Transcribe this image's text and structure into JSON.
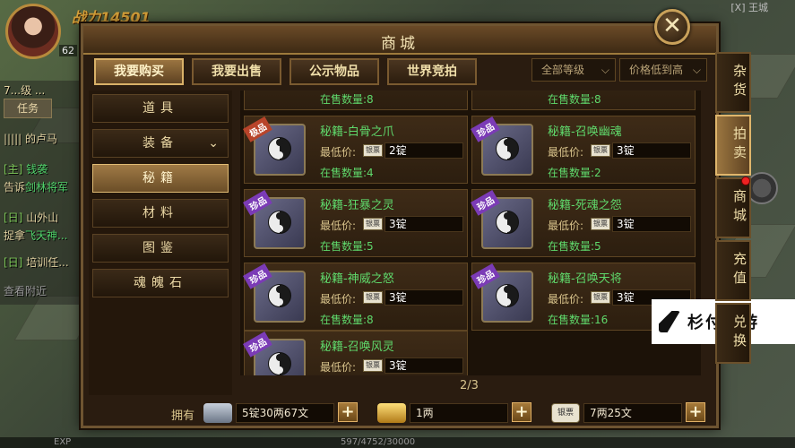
{
  "hud": {
    "power": "战力14501",
    "avatar_level": "62",
    "top_right_tag": "[X] 王城",
    "task_tab": "任务",
    "chat": [
      {
        "prefix": "7...级 ...",
        "text": ""
      },
      {
        "prefix": "||||| 的卢马",
        "text": ""
      },
      {
        "prefix": "[主]",
        "text": " 钱袭"
      },
      {
        "prefix": "告诉",
        "text": "剑林将军"
      },
      {
        "prefix": "[日]",
        "text": " 山外山"
      },
      {
        "prefix": "捉拿",
        "text": "飞天神..."
      },
      {
        "prefix": "[日]",
        "text": " 培训任..."
      },
      {
        "prefix": "查看附近",
        "text": ""
      }
    ],
    "bottom_status": "597/4752/30000",
    "exp_label": "EXP"
  },
  "shop": {
    "title": "商城",
    "close_icon": "close-icon",
    "tabs": [
      "我要购买",
      "我要出售",
      "公示物品",
      "世界竞拍"
    ],
    "active_tab": 0,
    "filters": {
      "level": "全部等级",
      "sort": "价格低到高"
    },
    "categories": [
      "道具",
      "装备",
      "秘籍",
      "材料",
      "图鉴",
      "魂魄石"
    ],
    "active_category": 2,
    "side_tabs": [
      "杂货",
      "拍卖",
      "商城",
      "充值",
      "兑换"
    ],
    "active_side_tab": 1,
    "labels": {
      "price": "最低价:",
      "stock": "在售数量:",
      "coin_icon": "银票",
      "owned": "拥有"
    },
    "partial_top_stocks": [
      "在售数量:8",
      "在售数量:8"
    ],
    "items": [
      {
        "name": "秘籍-白骨之爪",
        "badge": "极品",
        "price": "2锭",
        "stock": "4"
      },
      {
        "name": "秘籍-召唤幽魂",
        "badge": "珍品",
        "price": "3锭",
        "stock": "2"
      },
      {
        "name": "秘籍-狂暴之灵",
        "badge": "珍品",
        "price": "3锭",
        "stock": "5"
      },
      {
        "name": "秘籍-死魂之怨",
        "badge": "珍品",
        "price": "3锭",
        "stock": "5"
      },
      {
        "name": "秘籍-神威之怒",
        "badge": "珍品",
        "price": "3锭",
        "stock": "8"
      },
      {
        "name": "秘籍-召唤天将",
        "badge": "珍品",
        "price": "3锭",
        "stock": "16"
      },
      {
        "name": "秘籍-召唤风灵",
        "badge": "珍品",
        "price": "3锭",
        "stock": ""
      }
    ],
    "page": "2/3",
    "currencies": [
      {
        "icon": "silver-ingot-icon",
        "value": "5锭30两67文"
      },
      {
        "icon": "gold-ingot-icon",
        "value": "1两"
      },
      {
        "icon": "banknote-icon",
        "label": "银票",
        "value": "7两25文"
      }
    ]
  },
  "watermark": {
    "text": "杉付手游"
  },
  "colors": {
    "item_name": "#5fd86b",
    "rare_badge": "#7b3bb6",
    "epic_badge": "#b8442a",
    "frame": "#6e5431"
  }
}
